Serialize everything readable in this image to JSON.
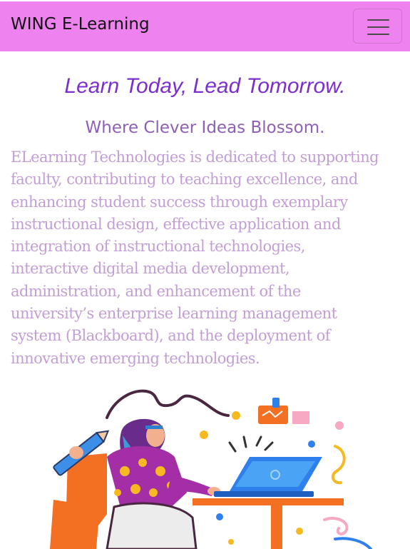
{
  "navbar": {
    "brand": "WING E-Learning",
    "toggler_icon": "hamburger-icon",
    "background": "#ee82ee"
  },
  "hero": {
    "tagline": "Learn Today, Lead Tomorrow.",
    "subheading": "Where Clever Ideas Blossom.",
    "description_lines": [
      "ELearning Technologies is dedicated to supporting",
      "faculty, contributing to teaching excellence, and",
      "enhancing student success through exemplary",
      "instructional design, effective application and",
      "integration of instructional technologies,",
      "interactive digital media development,",
      "administration, and enhancement of the",
      "university’s enterprise learning management",
      "system (Blackboard), and the deployment of",
      "innovative emerging technologies."
    ]
  },
  "colors": {
    "tagline": "#7b2fcf",
    "subheading": "#8e5fb6",
    "description": "#c29ed5"
  },
  "illustration": {
    "icon": "student-laptop-illustration"
  }
}
